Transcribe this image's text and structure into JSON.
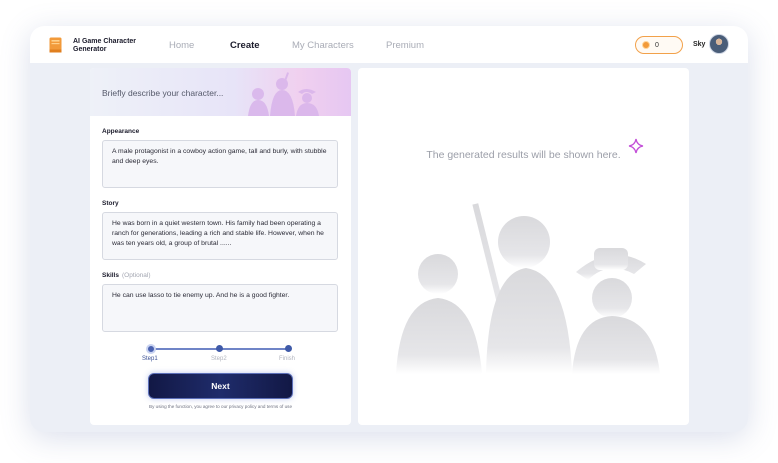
{
  "header": {
    "brand": "AI Game Character Generator",
    "nav": [
      {
        "label": "Home",
        "active": false
      },
      {
        "label": "Create",
        "active": true
      },
      {
        "label": "My Characters",
        "active": false
      },
      {
        "label": "Premium",
        "active": false
      }
    ],
    "coins": "0",
    "username": "Sky"
  },
  "form": {
    "banner_text": "Briefly describe your character...",
    "appearance": {
      "label": "Appearance",
      "value": "A male protagonist in a cowboy action game, tall and burly, with stubble and deep eyes."
    },
    "story": {
      "label": "Story",
      "value": "He was born in a quiet western town. His family had been operating a ranch for generations, leading a rich and stable life. However, when he was ten years old, a group of brutal ......"
    },
    "skills": {
      "label": "Skills",
      "optional": "(Optional)",
      "value": "He can use lasso to tie enemy up. And he is a good fighter."
    },
    "steps": [
      "Step1",
      "Step2",
      "Finish"
    ],
    "next_label": "Next",
    "terms": "By using the function, you agree to our privacy policy and terms of use"
  },
  "results": {
    "placeholder": "The generated results will be shown here."
  },
  "colors": {
    "accent": "#1f2c6b",
    "coin": "#f29a3a",
    "background": "#eceff6"
  },
  "icons": [
    "book-icon",
    "coin-icon",
    "sparkle-icon",
    "avatar"
  ]
}
